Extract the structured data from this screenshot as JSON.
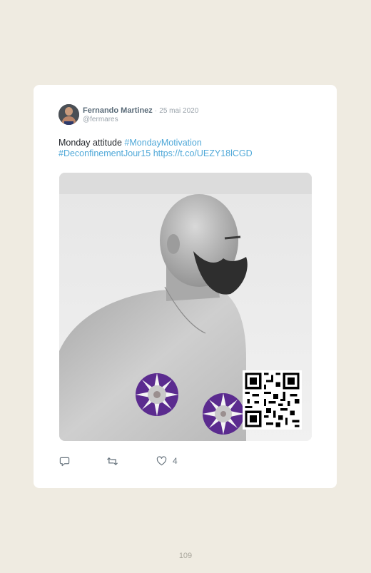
{
  "tweet": {
    "author_name": "Fernando Martinez",
    "separator": "·",
    "date": "25 mai 2020",
    "handle": "@fermares",
    "text_plain": "Monday attitude ",
    "hashtag_1": "#MondayMotivation",
    "hashtag_2": "#DeconfinementJour15",
    "link": "https://t.co/UEZY18lCGD"
  },
  "actions": {
    "reply_icon": "reply-icon",
    "retweet_icon": "retweet-icon",
    "like_icon": "heart-icon",
    "like_count": "4"
  },
  "page": {
    "number": "109"
  },
  "colors": {
    "background": "#efebe1",
    "card": "#ffffff",
    "link": "#4fa8d8",
    "sticker": "#5b2b8f"
  }
}
